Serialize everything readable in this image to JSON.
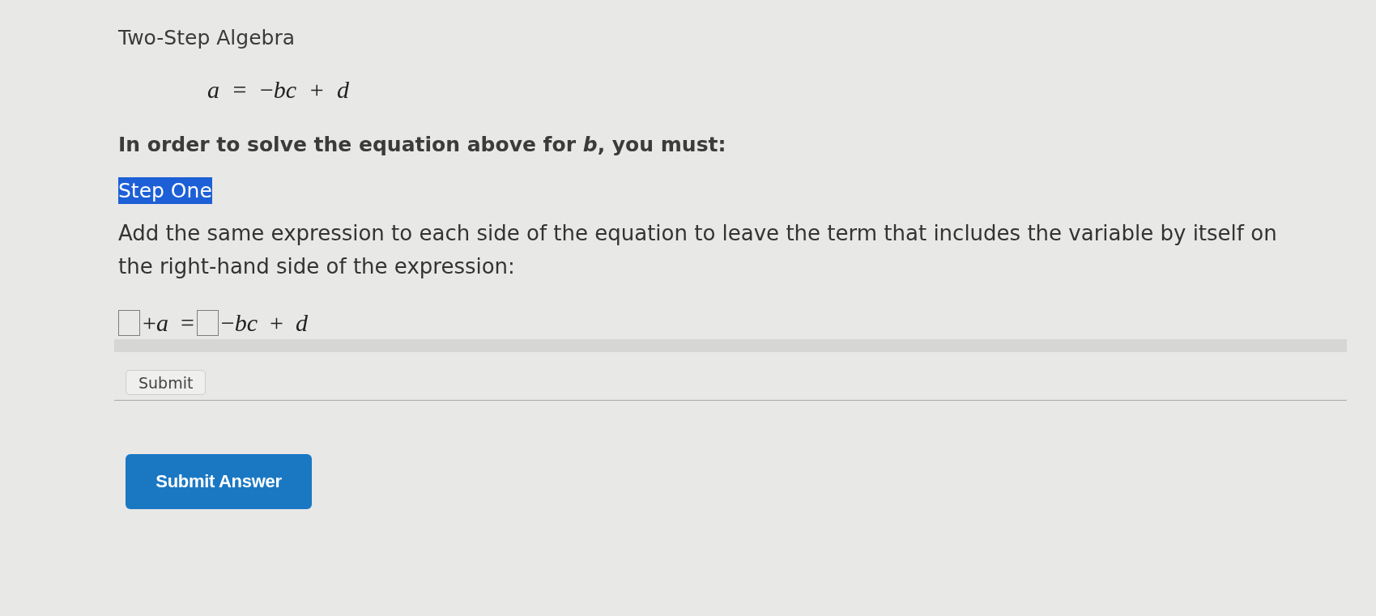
{
  "title": "Two-Step Algebra",
  "equation": "*a* = −*bc* + *d*",
  "instruction": "In order to solve the equation above for *b*, you must:",
  "step": {
    "label": "Step One",
    "highlighted": true
  },
  "step_text": "Add the same expression to each side of the equation to leave the term that includes the variable by itself on the right-hand side of the expression:",
  "answer_row": [
    {
      "kind": "answer-box"
    },
    {
      "kind": "math",
      "text": "+*a* ="
    },
    {
      "kind": "answer-box"
    },
    {
      "kind": "math",
      "text": "−*bc* + *d*"
    }
  ],
  "submit_button": "Submit",
  "submit_answer_button": "Submit Answer"
}
